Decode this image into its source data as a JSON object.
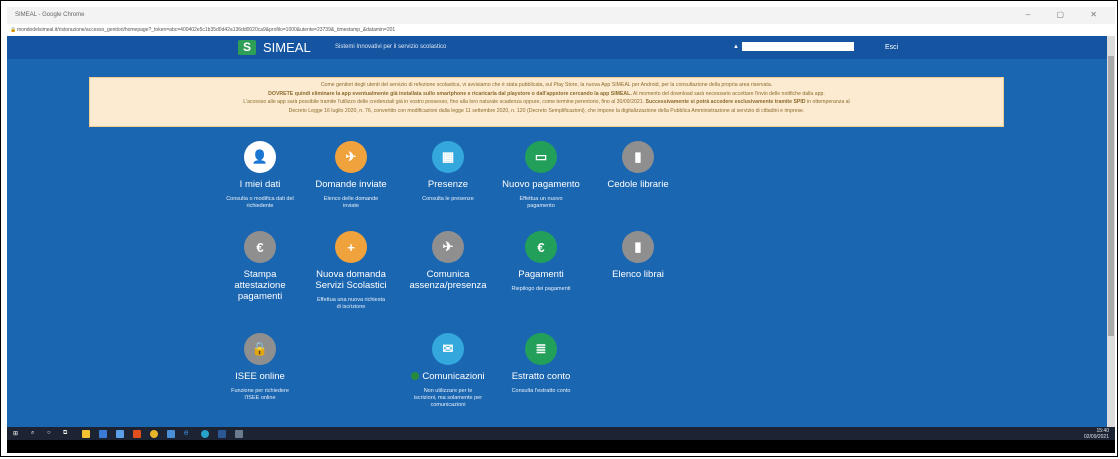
{
  "browser": {
    "window_title": "SIMEAL - Google Chrome",
    "url": "mondodelsimeal.it/ristorazione/accesso_genitori/homepage?_token=abc=400402e5c1b35d0d42a136dd0020ca9&profilo=1000&utente=23739&_timestamp_&datamin=201",
    "window_controls": "– ▢ ✕"
  },
  "header": {
    "logo_letter": "S",
    "brand": "SIMEAL",
    "tagline": "Sistemi Innovativi per il servizio scolastico",
    "logout_label": "Esci",
    "user_icon": "person-icon"
  },
  "notice": {
    "line1": "Come genitori degli utenti del servizio di refezione scolastica, vi avvisiamo che è stata pubblicata, sul Play Store, la nuova App SIMEAL per Android, per la consultazione della propria area riservata.",
    "line2_bold": "DOVRETE quindi eliminare la app eventualmente già installata sullo smartphone e ricaricarla dal playstore o dall'appstore cercando la app SIMEAL.",
    "line2_rest": " Al momento del download sarà necessario accettare l'invio delle notifiche dalla app.",
    "line3": "L'accesso alle app sarà possibile tramite l'utilizzo delle credenziali già in vostro possesso, fino alla loro naturale scadenza oppure, come termine perentorio, fino al 30/09/2021.",
    "line3_bold": " Successivamente si potrà accedere esclusivamente tramite SPID",
    "line3_rest": " in ottemperanza al",
    "line4": "Decreto Legge 16 luglio 2020, n. 76, convertito con modificazioni dalla legge 11 settembre 2020, n. 120 (Decreto Semplificazioni), che impone la digitalizzazione della Pubblica Amministrazione al servizio di cittadini e imprese."
  },
  "tiles": [
    {
      "icon": "person-icon",
      "glyph": "👤",
      "color": "#ffffff",
      "label": "I miei dati",
      "desc": "Consulta o modifica dati del richiedente"
    },
    {
      "icon": "send-icon",
      "glyph": "✈",
      "color": "#f0a23c",
      "label": "Domande inviate",
      "desc": "Elenco delle domande inviate"
    },
    {
      "icon": "calendar-icon",
      "glyph": "▦",
      "color": "#34a7dc",
      "label": "Presenze",
      "desc": "Consulta le presenze"
    },
    {
      "icon": "credit-card-icon",
      "glyph": "▭",
      "color": "#22a05a",
      "label": "Nuovo pagamento",
      "desc": "Effettua un nuovo pagamento"
    },
    {
      "icon": "book-icon",
      "glyph": "▮",
      "color": "#8f8f8f",
      "label": "Cedole librarie",
      "desc": ""
    },
    {
      "icon": "euro-icon",
      "glyph": "€",
      "color": "#8f8f8f",
      "label": "Stampa attestazione pagamenti",
      "desc": ""
    },
    {
      "icon": "plus-icon",
      "glyph": "+",
      "color": "#f0a23c",
      "label": "Nuova domanda Servizi Scolastici",
      "desc": "Effettua una nuova richiesta di iscrizione"
    },
    {
      "icon": "send-icon",
      "glyph": "✈",
      "color": "#8f8f8f",
      "label": "Comunica assenza/presenza",
      "desc": ""
    },
    {
      "icon": "euro-icon",
      "glyph": "€",
      "color": "#22a05a",
      "label": "Pagamenti",
      "desc": "Riepilogo dei pagamenti"
    },
    {
      "icon": "book-icon",
      "glyph": "▮",
      "color": "#8f8f8f",
      "label": "Elenco librai",
      "desc": ""
    },
    {
      "icon": "lock-icon",
      "glyph": "🔒",
      "color": "#8f8f8f",
      "label": "ISEE online",
      "desc": "Funzione per richiedere l'ISEE online"
    },
    {
      "icon": "envelope-icon",
      "glyph": "✉",
      "color": "#34a7dc",
      "label": "Comunicazioni",
      "desc": "Non utilizzare per le iscrizioni, ma solamente per comunicazioni"
    },
    {
      "icon": "list-icon",
      "glyph": "≣",
      "color": "#22a05a",
      "label": "Estratto conto",
      "desc": "Consulta l'estratto conto"
    }
  ],
  "taskbar": {
    "start_icon": "windows-icon",
    "search_icon": "search-icon",
    "cortana_icon": "circle-icon",
    "taskview_icon": "task-view-icon",
    "pinned": [
      "file-explorer-icon",
      "mail-icon",
      "store-icon",
      "office-icon",
      "chrome-icon",
      "photos-icon",
      "edge-icon",
      "edge-chromium-icon",
      "word-icon",
      "app-icon"
    ],
    "clock_time": "15:40",
    "clock_date": "02/09/2021"
  }
}
